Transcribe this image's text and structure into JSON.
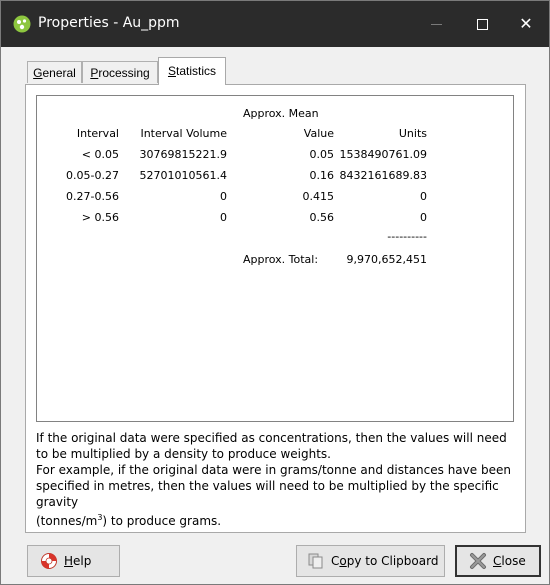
{
  "window": {
    "title": "Properties - Au_ppm",
    "icon": "leapfrog-app-icon",
    "controls": {
      "minimize": "minimize-icon",
      "maximize": "maximize-icon",
      "close_glyph": "✕"
    }
  },
  "tabs": [
    {
      "label_first": "G",
      "label_rest": "eneral"
    },
    {
      "label_first": "P",
      "label_rest": "rocessing"
    },
    {
      "label_first": "S",
      "label_rest": "tatistics"
    }
  ],
  "active_tab": "Statistics",
  "table": {
    "header_top": "Approx. Mean",
    "headers": [
      "Interval",
      "Interval Volume",
      "Value",
      "Units"
    ],
    "rows": [
      [
        "< 0.05",
        "30769815221.9",
        "0.05",
        "1538490761.09"
      ],
      [
        "0.05-0.27",
        "52701010561.4",
        "0.16",
        "8432161689.83"
      ],
      [
        "0.27-0.56",
        "0",
        "0.415",
        "0"
      ],
      [
        "> 0.56",
        "0",
        "0.56",
        "0"
      ]
    ],
    "separator": "----------",
    "total_label": "Approx. Total:",
    "total_value": "9,970,652,451"
  },
  "note": {
    "line1": "If the original data were specified as concentrations, then the values will need to be multiplied by a density to produce weights.",
    "line2": "For example, if the original data were in grams/tonne and distances have been specified in metres, then the values will need to be multiplied by the specific gravity",
    "line3_pre": "(tonnes/m",
    "line3_sup": "3",
    "line3_post": ") to produce grams."
  },
  "buttons": {
    "help_first": "H",
    "help_rest": "elp",
    "copy_pre": "C",
    "copy_mid": "o",
    "copy_rest": "py to Clipboard",
    "close_first": "C",
    "close_rest": "lose"
  }
}
